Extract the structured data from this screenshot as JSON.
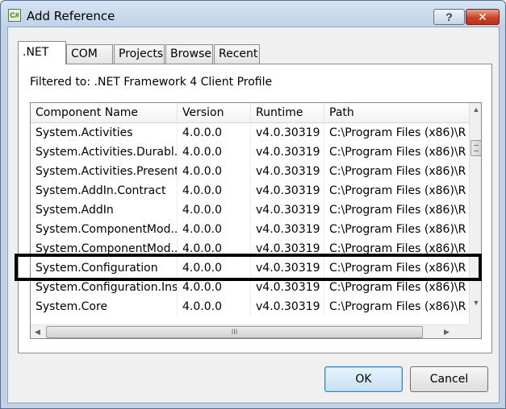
{
  "window": {
    "title": "Add Reference",
    "icon_text": "C#",
    "help_label": "?",
    "close_label": "✕"
  },
  "tabs": [
    {
      "label": ".NET",
      "active": true
    },
    {
      "label": "COM",
      "active": false
    },
    {
      "label": "Projects",
      "active": false
    },
    {
      "label": "Browse",
      "active": false
    },
    {
      "label": "Recent",
      "active": false
    }
  ],
  "filter": {
    "text": "Filtered to: .NET Framework 4 Client Profile"
  },
  "list": {
    "columns": [
      "Component Name",
      "Version",
      "Runtime",
      "Path"
    ],
    "rows": [
      [
        "System.Activities",
        "4.0.0.0",
        "v4.0.30319",
        "C:\\Program Files (x86)\\R"
      ],
      [
        "System.Activities.Durabl...",
        "4.0.0.0",
        "v4.0.30319",
        "C:\\Program Files (x86)\\R"
      ],
      [
        "System.Activities.Present...",
        "4.0.0.0",
        "v4.0.30319",
        "C:\\Program Files (x86)\\R"
      ],
      [
        "System.AddIn.Contract",
        "4.0.0.0",
        "v4.0.30319",
        "C:\\Program Files (x86)\\R"
      ],
      [
        "System.AddIn",
        "4.0.0.0",
        "v4.0.30319",
        "C:\\Program Files (x86)\\R"
      ],
      [
        "System.ComponentMod...",
        "4.0.0.0",
        "v4.0.30319",
        "C:\\Program Files (x86)\\R"
      ],
      [
        "System.ComponentMod...",
        "4.0.0.0",
        "v4.0.30319",
        "C:\\Program Files (x86)\\R"
      ],
      [
        "System.Configuration",
        "4.0.0.0",
        "v4.0.30319",
        "C:\\Program Files (x86)\\R"
      ],
      [
        "System.Configuration.Ins...",
        "4.0.0.0",
        "v4.0.30319",
        "C:\\Program Files (x86)\\R"
      ],
      [
        "System.Core",
        "4.0.0.0",
        "v4.0.30319",
        "C:\\Program Files (x86)\\R"
      ]
    ],
    "highlighted_row": 7
  },
  "scrollbars": {
    "up_arrow": "▲",
    "down_arrow": "▼",
    "left_arrow": "◀",
    "right_arrow": "▶",
    "thumb_grip": "III"
  },
  "buttons": {
    "ok_label": "OK",
    "cancel_label": "Cancel"
  },
  "colors": {
    "title_gradient_top": "#d7e4f3",
    "close_red": "#c9442a",
    "default_button_blue": "#c4e0f4",
    "highlight_border": "#000000"
  }
}
